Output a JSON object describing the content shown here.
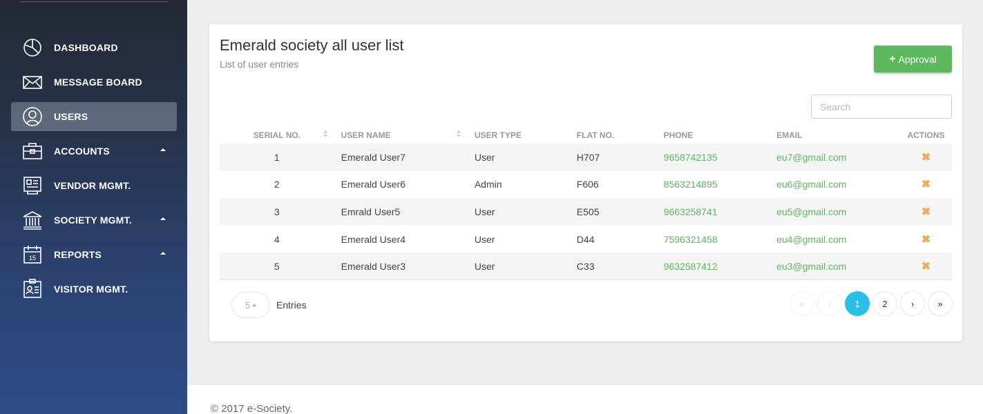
{
  "sidebar": {
    "items": [
      {
        "label": "DASHBOARD",
        "icon": "dashboard-icon",
        "active": false
      },
      {
        "label": "MESSAGE BOARD",
        "icon": "envelope-icon",
        "active": false
      },
      {
        "label": "USERS",
        "icon": "user-icon",
        "active": true
      },
      {
        "label": "ACCOUNTS",
        "icon": "briefcase-icon",
        "active": false
      },
      {
        "label": "VENDOR MGMT.",
        "icon": "vendor-icon",
        "active": false
      },
      {
        "label": "SOCIETY MGMT.",
        "icon": "bank-icon",
        "active": false
      },
      {
        "label": "REPORTS",
        "icon": "calendar-icon",
        "active": false,
        "calendar_day": "15"
      },
      {
        "label": "VISITOR MGMT.",
        "icon": "id-card-icon",
        "active": false
      }
    ]
  },
  "card": {
    "title": "Emerald society all user list",
    "subtitle": "List of user entries",
    "approval_button": {
      "icon": "+",
      "label": "Approval"
    },
    "search_placeholder": "Search"
  },
  "table": {
    "headers": [
      "SERIAL NO.",
      "USER NAME",
      "USER TYPE",
      "FLAT NO.",
      "PHONE",
      "EMAIL",
      "ACTIONS"
    ],
    "rows": [
      {
        "serial": "1",
        "name": "Emerald User7",
        "type": "User",
        "flat": "H707",
        "phone": "9658742135",
        "email": "eu7@gmail.com",
        "action": "✖"
      },
      {
        "serial": "2",
        "name": "Emerald User6",
        "type": "Admin",
        "flat": "F606",
        "phone": "8563214895",
        "email": "eu6@gmail.com",
        "action": "✖"
      },
      {
        "serial": "3",
        "name": "Emrald User5",
        "type": "User",
        "flat": "E505",
        "phone": "9663258741",
        "email": "eu5@gmail.com",
        "action": "✖"
      },
      {
        "serial": "4",
        "name": "Emerald User4",
        "type": "User",
        "flat": "D44",
        "phone": "7596321458",
        "email": "eu4@gmail.com",
        "action": "✖"
      },
      {
        "serial": "5",
        "name": "Emerald User3",
        "type": "User",
        "flat": "C33",
        "phone": "9632587412",
        "email": "eu3@gmail.com",
        "action": "✖"
      }
    ]
  },
  "pagination": {
    "entries_value": "5",
    "entries_label": "Entries",
    "first": "«",
    "prev": "‹",
    "pages": [
      "1",
      "2"
    ],
    "current_page": "1",
    "next": "›",
    "last": "»"
  },
  "footer": {
    "text": "© 2017 e-Society."
  },
  "colors": {
    "accent_green": "#5cb85c",
    "active_page": "#29c0e8",
    "delete_orange": "#f0ad4e"
  }
}
